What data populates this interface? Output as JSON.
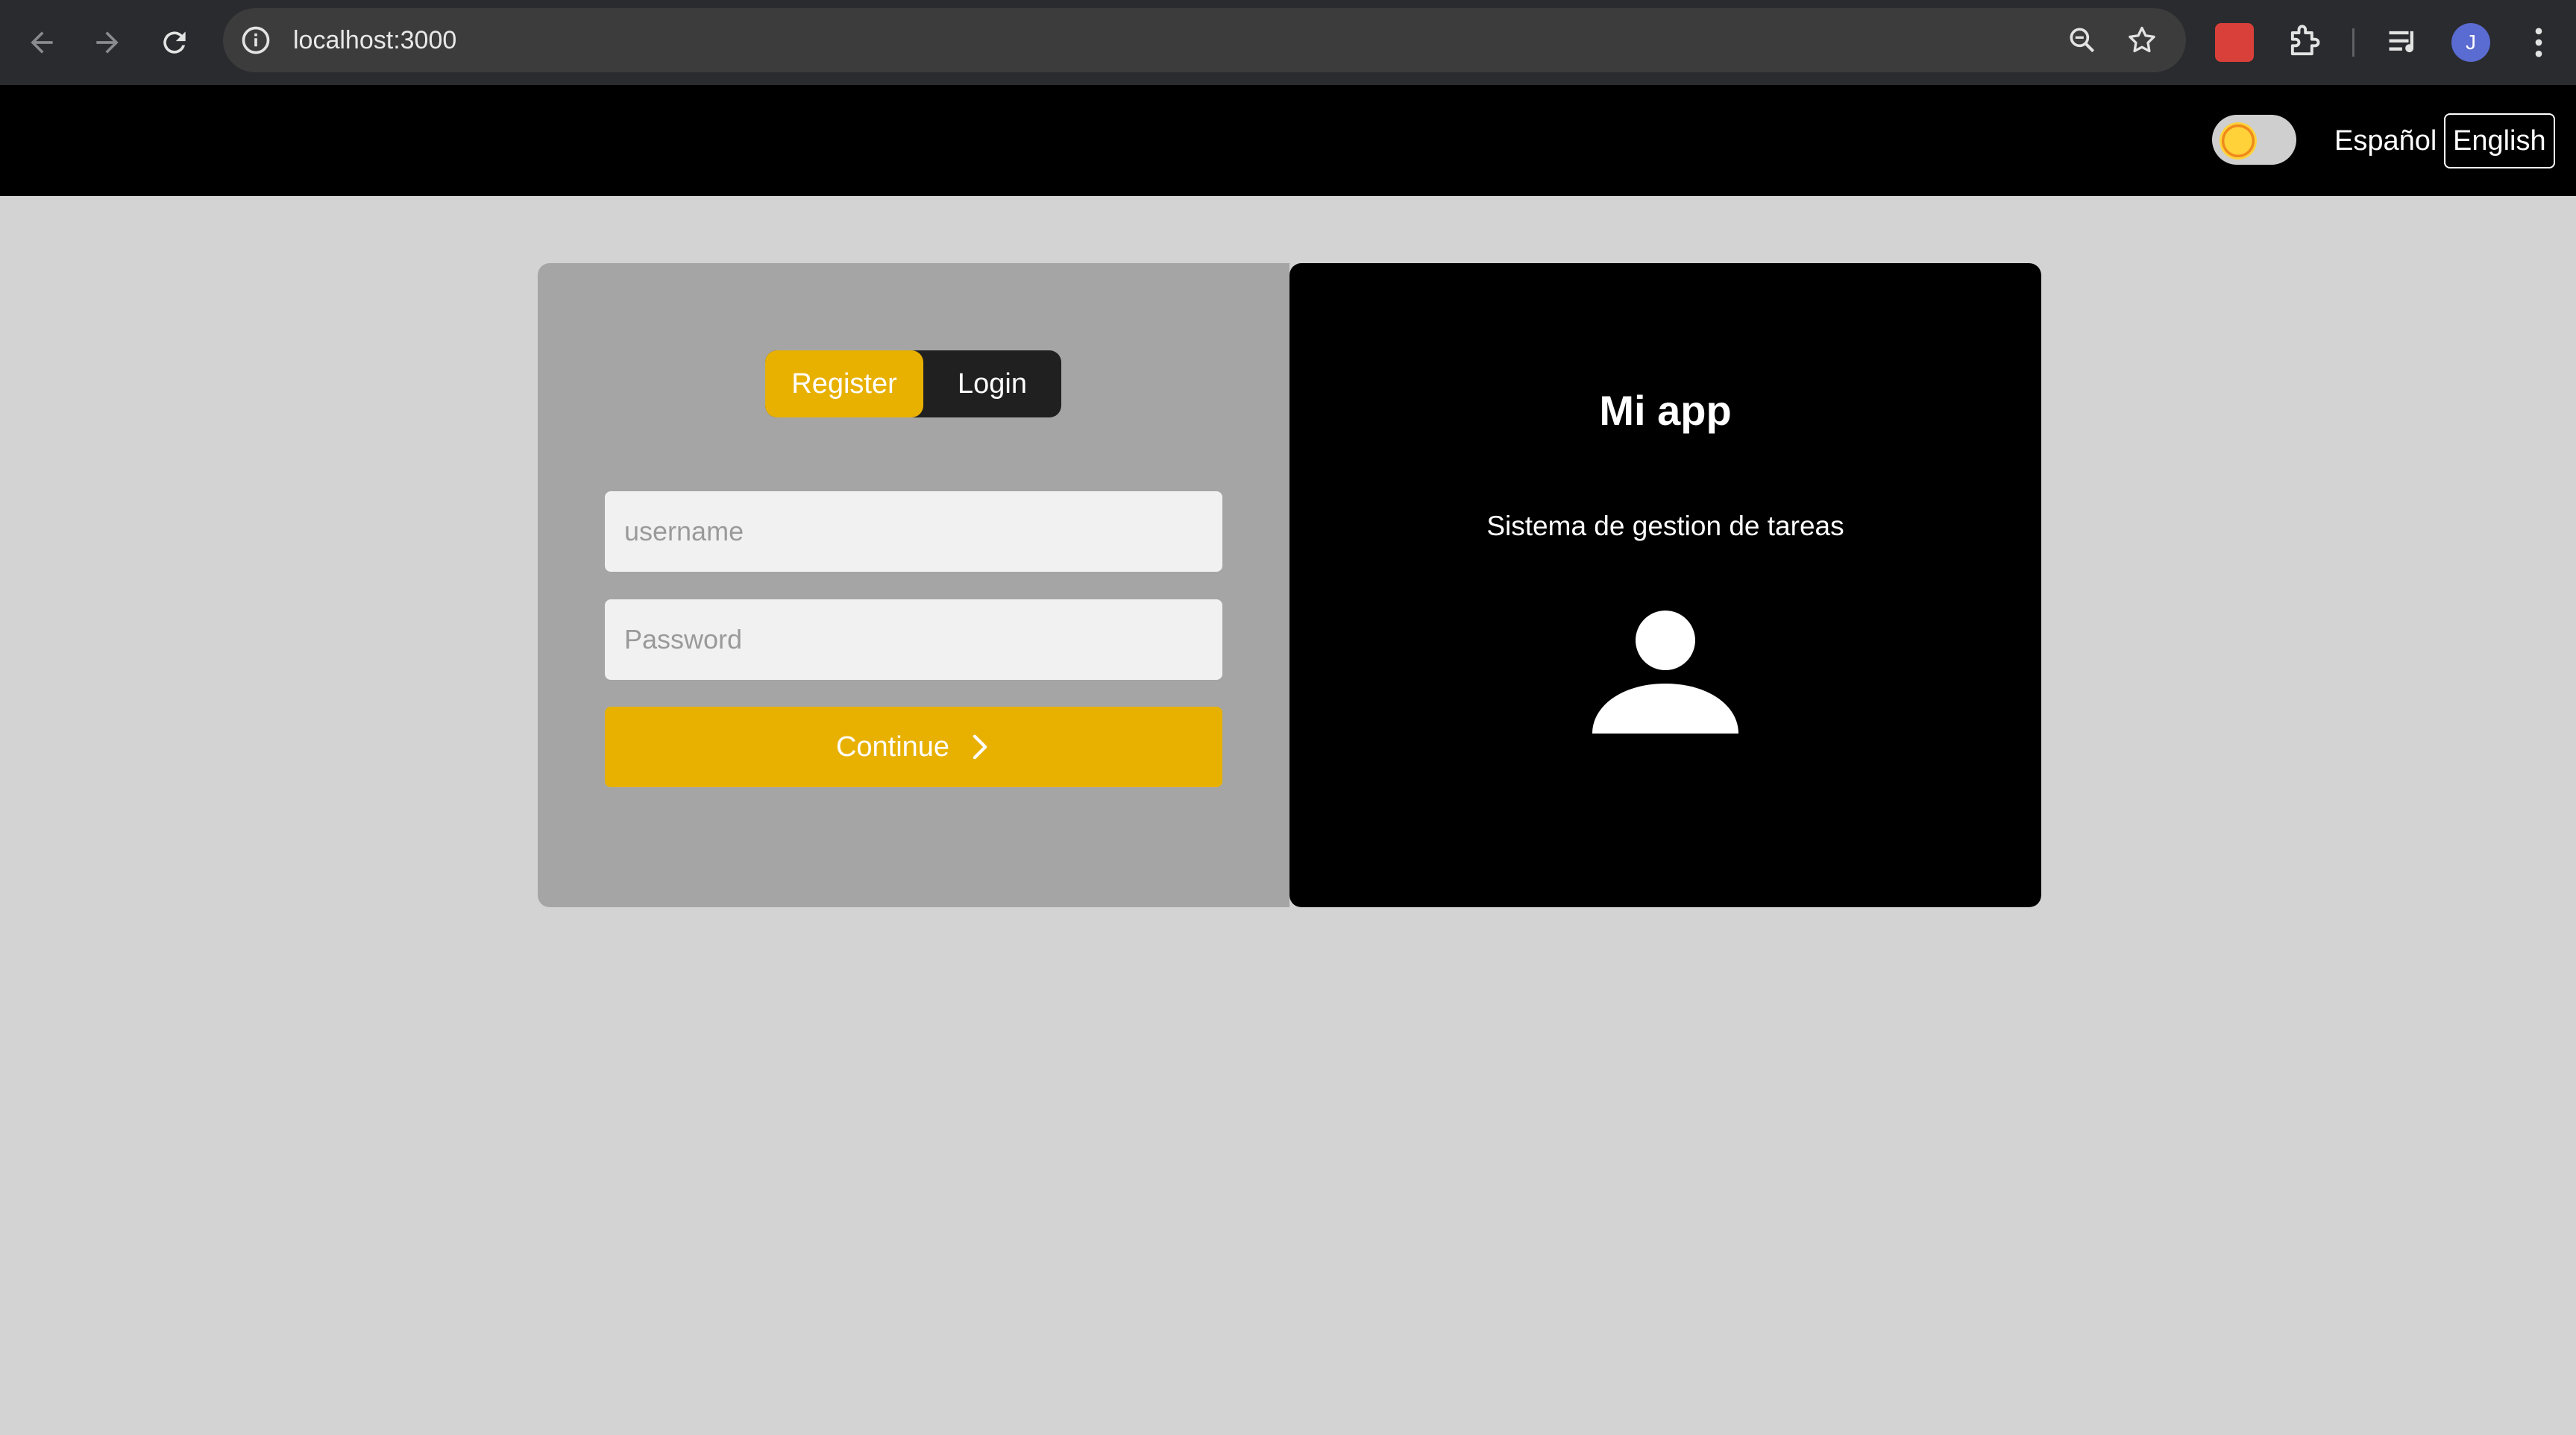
{
  "browser": {
    "url": "localhost:3000",
    "profile_initial": "J"
  },
  "header": {
    "theme_toggle_icon": "sun-icon",
    "languages": [
      "Español",
      "English"
    ],
    "active_language": "English"
  },
  "auth": {
    "tabs": {
      "register": "Register",
      "login": "Login"
    },
    "active_tab": "Register",
    "username_placeholder": "username",
    "password_placeholder": "Password",
    "username_value": "",
    "password_value": "",
    "continue_label": "Continue"
  },
  "info_panel": {
    "title": "Mi app",
    "subtitle": "Sistema de gestion de tareas",
    "icon": "user-icon"
  },
  "colors": {
    "accent": "#e8b100",
    "page_bg": "#d3d3d3",
    "left_panel": "#a5a5a5",
    "right_panel": "#000000"
  }
}
